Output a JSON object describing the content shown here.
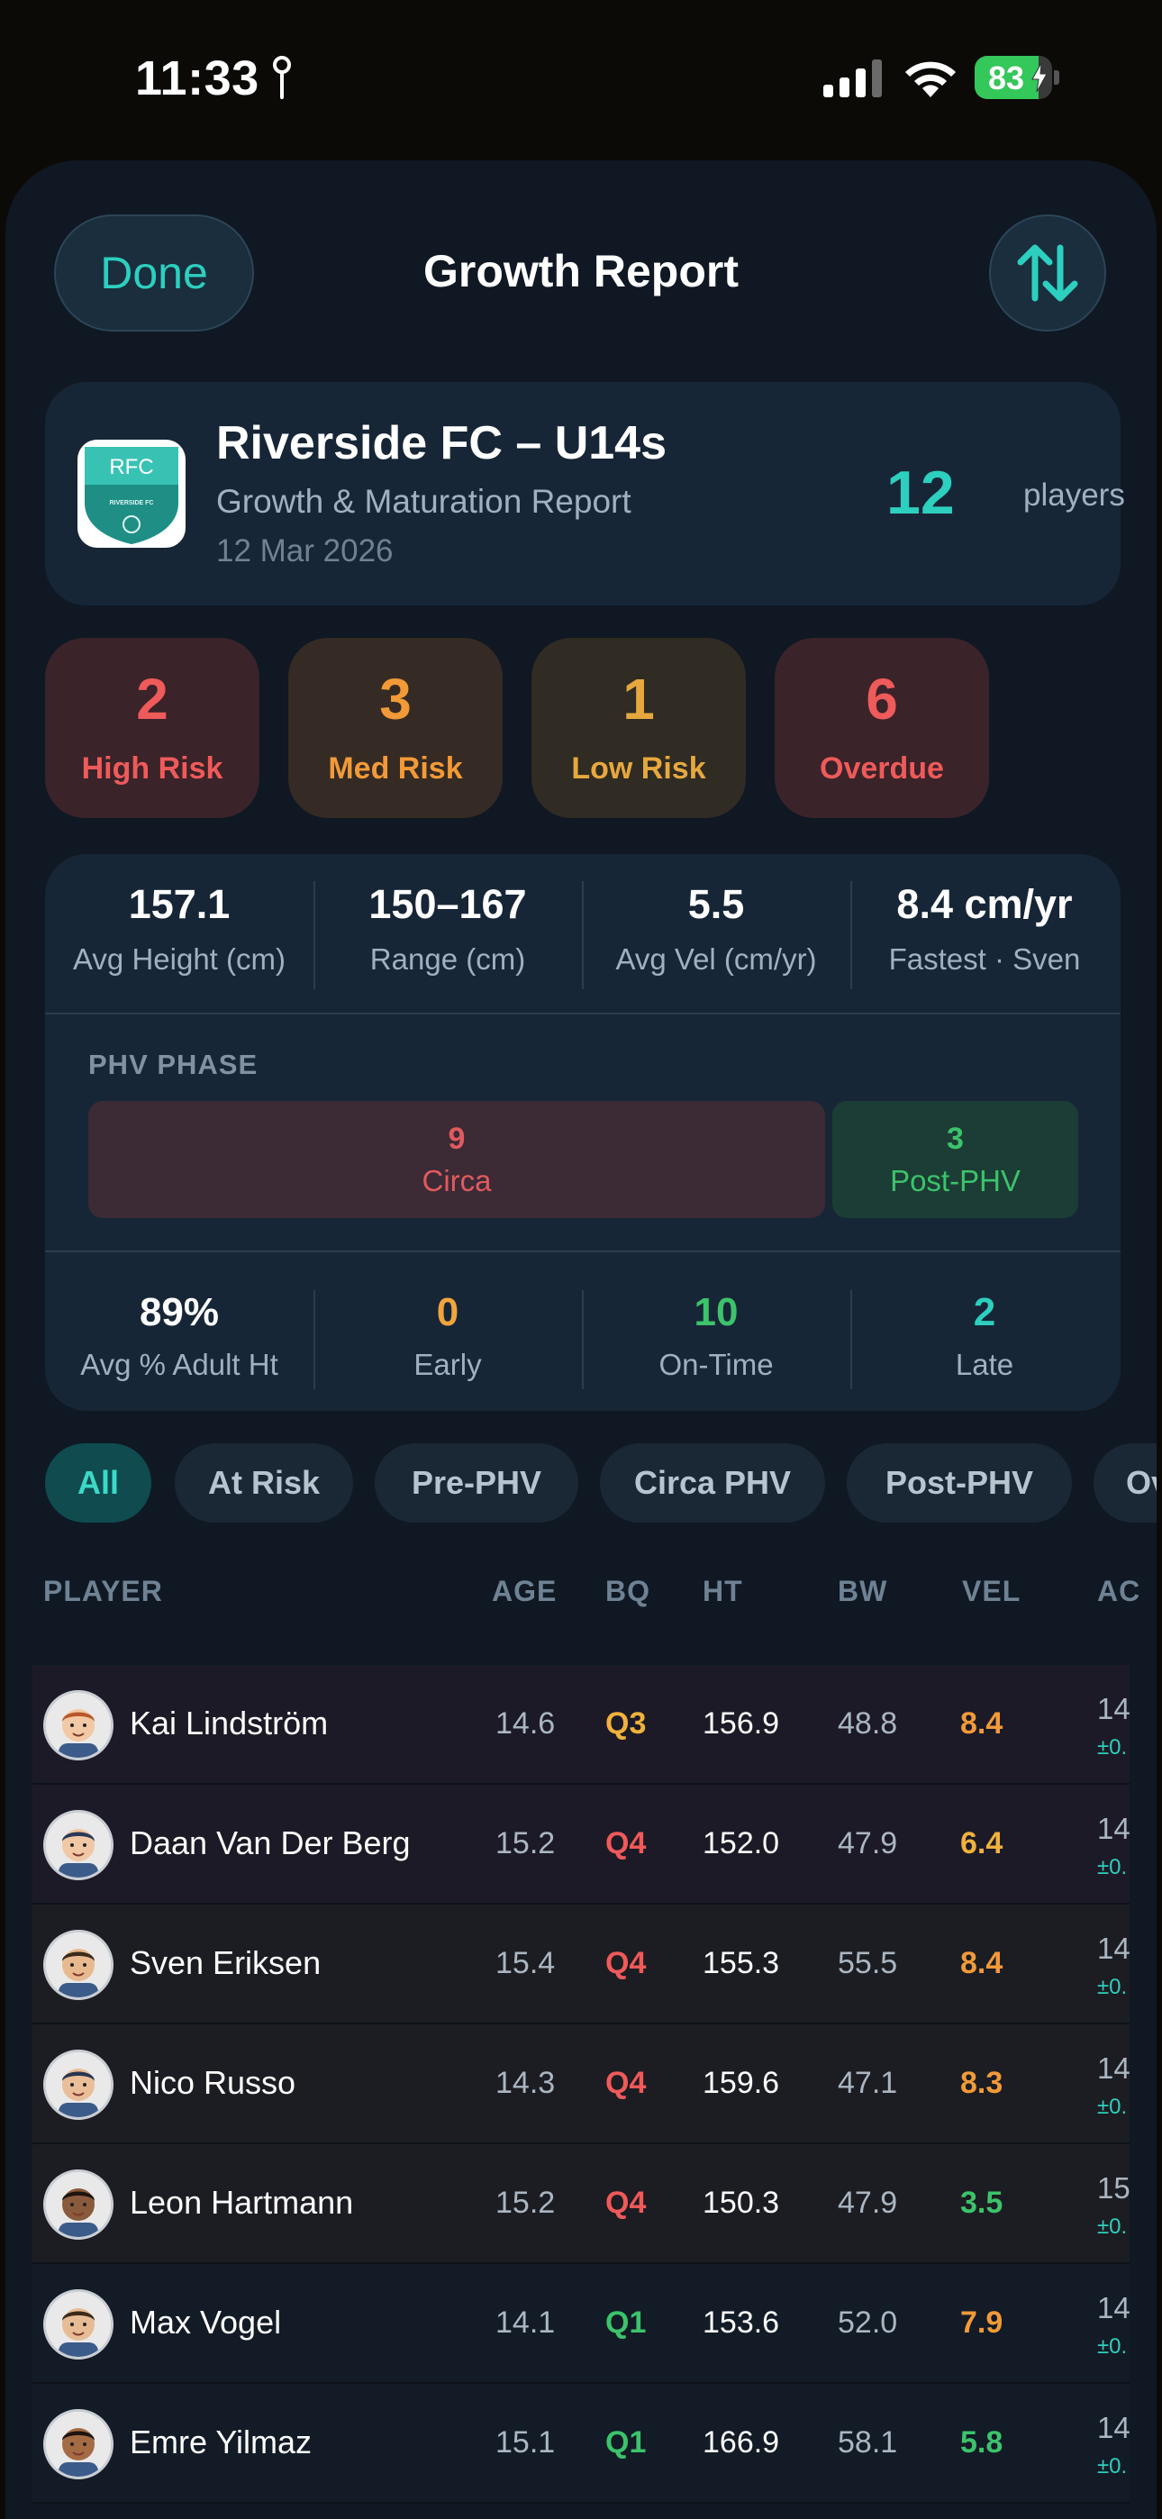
{
  "status_bar": {
    "time": "11:33",
    "battery": "83",
    "battery_level_percent": 83,
    "icons": [
      "location-icon",
      "cellular-signal-icon",
      "wifi-icon",
      "battery-charging-icon"
    ]
  },
  "header": {
    "done_label": "Done",
    "title": "Growth Report",
    "sort_icon": "sort-arrows-icon"
  },
  "team": {
    "badge_text": "RFC",
    "badge_subtext": "RIVERSIDE FC",
    "name": "Riverside FC – U14s",
    "subtitle": "Growth & Maturation Report",
    "date": "12 Mar 2026",
    "player_count": "12",
    "player_count_label": "players"
  },
  "risk": [
    {
      "value": "2",
      "label": "High Risk",
      "color": "#ef5a5a",
      "bg": "#3a2329"
    },
    {
      "value": "3",
      "label": "Med Risk",
      "color": "#f29a38",
      "bg": "#352b24"
    },
    {
      "value": "1",
      "label": "Low Risk",
      "color": "#e6a83e",
      "bg": "#302b23"
    },
    {
      "value": "6",
      "label": "Overdue",
      "color": "#ef5a5a",
      "bg": "#3a2329"
    }
  ],
  "stats": [
    {
      "value": "157.1",
      "label": "Avg Height (cm)"
    },
    {
      "value": "150–167",
      "label": "Range (cm)"
    },
    {
      "value": "5.5",
      "label": "Avg Vel (cm/yr)"
    },
    {
      "value": "8.4 cm/yr",
      "label": "Fastest · Sven"
    }
  ],
  "phv": {
    "title": "PHV PHASE",
    "segments": [
      {
        "count": "9",
        "label": "Circa",
        "value": 9,
        "color": "#e05a5e",
        "bg": "#3c2a35"
      },
      {
        "count": "3",
        "label": "Post-PHV",
        "value": 3,
        "color": "#3cc36b",
        "bg": "#1c3d35"
      }
    ]
  },
  "maturation": [
    {
      "value": "89%",
      "label": "Avg % Adult Ht",
      "color": "#ffffff"
    },
    {
      "value": "0",
      "label": "Early",
      "color": "#f0a53c"
    },
    {
      "value": "10",
      "label": "On-Time",
      "color": "#3cc36b"
    },
    {
      "value": "2",
      "label": "Late",
      "color": "#2dcfbf"
    }
  ],
  "filters": [
    "All",
    "At Risk",
    "Pre-PHV",
    "Circa PHV",
    "Post-PHV",
    "Ov"
  ],
  "active_filter": "All",
  "table": {
    "headers": [
      "PLAYER",
      "AGE",
      "BQ",
      "HT",
      "BW",
      "VEL",
      "AC"
    ],
    "rows": [
      {
        "name": "Kai Lindström",
        "age": "14.6",
        "bq": "Q3",
        "ht": "156.9",
        "bw": "48.8",
        "vel": "8.4",
        "ac": "14",
        "ac_sub": "±0.",
        "bq_color": "#f0b23c",
        "vel_color": "#f29a38",
        "row_bg": "#1c1a26"
      },
      {
        "name": "Daan Van Der Berg",
        "age": "15.2",
        "bq": "Q4",
        "ht": "152.0",
        "bw": "47.9",
        "vel": "6.4",
        "ac": "14",
        "ac_sub": "±0.",
        "bq_color": "#ef5a5a",
        "vel_color": "#f0b23c",
        "row_bg": "#1c1a26"
      },
      {
        "name": "Sven Eriksen",
        "age": "15.4",
        "bq": "Q4",
        "ht": "155.3",
        "bw": "55.5",
        "vel": "8.4",
        "ac": "14",
        "ac_sub": "±0.",
        "bq_color": "#ef5a5a",
        "vel_color": "#f29a38",
        "row_bg": "#1c1d22"
      },
      {
        "name": "Nico Russo",
        "age": "14.3",
        "bq": "Q4",
        "ht": "159.6",
        "bw": "47.1",
        "vel": "8.3",
        "ac": "14",
        "ac_sub": "±0.",
        "bq_color": "#ef5a5a",
        "vel_color": "#f29a38",
        "row_bg": "#1c1d22"
      },
      {
        "name": "Leon Hartmann",
        "age": "15.2",
        "bq": "Q4",
        "ht": "150.3",
        "bw": "47.9",
        "vel": "3.5",
        "ac": "15",
        "ac_sub": "±0.",
        "bq_color": "#ef5a5a",
        "vel_color": "#3cc36b",
        "row_bg": "#1c1d22"
      },
      {
        "name": "Max Vogel",
        "age": "14.1",
        "bq": "Q1",
        "ht": "153.6",
        "bw": "52.0",
        "vel": "7.9",
        "ac": "14",
        "ac_sub": "±0.",
        "bq_color": "#3cc36b",
        "vel_color": "#f29a38",
        "row_bg": "#121b26"
      },
      {
        "name": "Emre Yilmaz",
        "age": "15.1",
        "bq": "Q1",
        "ht": "166.9",
        "bw": "58.1",
        "vel": "5.8",
        "ac": "14",
        "ac_sub": "±0.",
        "bq_color": "#3cc36b",
        "vel_color": "#3cc36b",
        "row_bg": "#121b26"
      }
    ]
  }
}
